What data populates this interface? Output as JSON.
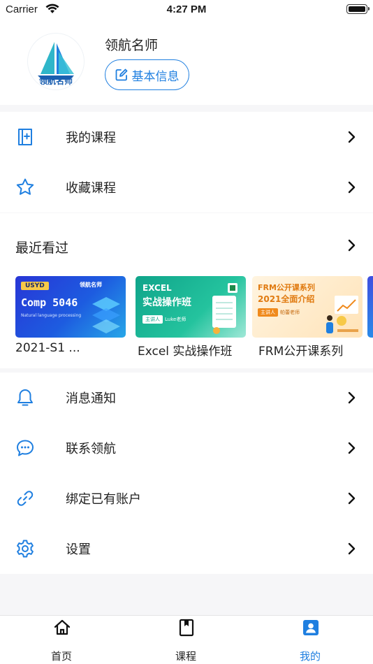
{
  "status_bar": {
    "carrier": "Carrier",
    "time": "4:27 PM"
  },
  "profile": {
    "avatar_text": "领航名师",
    "name": "领航名师",
    "edit_label": "基本信息"
  },
  "menu_top": [
    {
      "label": "我的课程",
      "icon": "course-book-icon"
    },
    {
      "label": "收藏课程",
      "icon": "star-icon"
    }
  ],
  "recent": {
    "title": "最近看过",
    "items": [
      {
        "caption": "2021-S1 ...",
        "badge": "USYD",
        "brand": "领航名师",
        "heading": "Comp 5046",
        "sub": "Natural language processing"
      },
      {
        "caption": "Excel 实战操作班",
        "heading1": "EXCEL",
        "heading2": "实战操作班",
        "tag": "主讲人",
        "teacher": "Luke老师"
      },
      {
        "caption": "FRM公开课系列",
        "heading1": "FRM公开课系列",
        "heading2": "2021全面介绍",
        "tag": "主讲人",
        "teacher": "帕蕾老师"
      }
    ]
  },
  "menu_bottom": [
    {
      "label": "消息通知",
      "icon": "bell-icon"
    },
    {
      "label": "联系领航",
      "icon": "chat-bubble-icon"
    },
    {
      "label": "绑定已有账户",
      "icon": "link-icon"
    },
    {
      "label": "设置",
      "icon": "gear-icon"
    }
  ],
  "tabbar": [
    {
      "label": "首页",
      "icon": "home-icon",
      "active": false
    },
    {
      "label": "课程",
      "icon": "bookmark-book-icon",
      "active": false
    },
    {
      "label": "我的",
      "icon": "profile-card-icon",
      "active": true
    }
  ],
  "colors": {
    "accent": "#1f7fe0",
    "background": "#f6f6f8"
  }
}
